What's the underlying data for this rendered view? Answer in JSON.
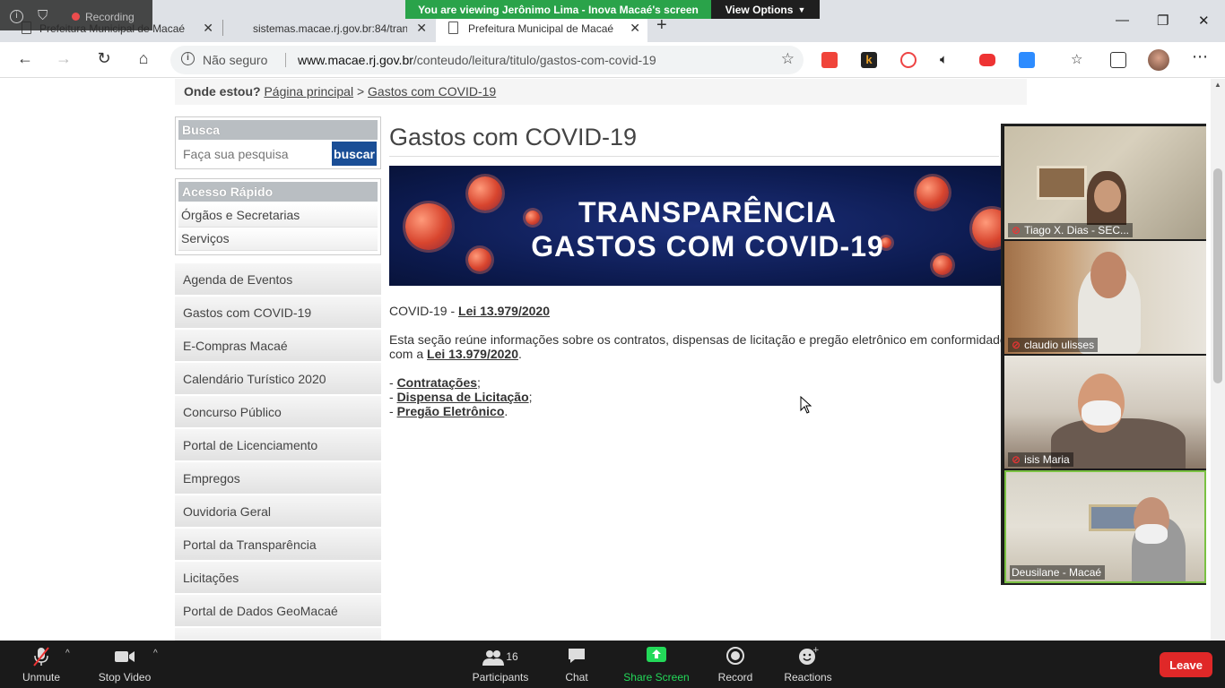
{
  "zoom": {
    "recording_label": "Recording",
    "viewing_banner": "You are viewing Jerônimo Lima - Inova Macaé's screen",
    "view_options_label": "View Options",
    "participants_count": "16",
    "toolbar": {
      "unmute": "Unmute",
      "stop_video": "Stop Video",
      "participants": "Participants",
      "chat": "Chat",
      "share_screen": "Share Screen",
      "record": "Record",
      "reactions": "Reactions",
      "leave": "Leave"
    },
    "participants": [
      {
        "name": "Tiago X. Dias - SEC...",
        "muted": true
      },
      {
        "name": "claudio ulisses",
        "muted": true
      },
      {
        "name": "isis Maria",
        "muted": true
      },
      {
        "name": "Deusilane - Macaé",
        "muted": false
      }
    ],
    "colors": {
      "banner": "#2aa34a",
      "leave": "#e02828",
      "share": "#23d959"
    }
  },
  "browser": {
    "tabs": [
      {
        "title": "Prefeitura Municipal de Macaé",
        "active": false
      },
      {
        "title": "sistemas.macae.rj.gov.br:84/tran",
        "active": false
      },
      {
        "title": "Prefeitura Municipal de Macaé",
        "active": true
      }
    ],
    "security_label": "Não seguro",
    "url_host": "www.macae.rj.gov.br",
    "url_path": "/conteudo/leitura/titulo/gastos-com-covid-19"
  },
  "page": {
    "breadcrumb": {
      "label": "Onde estou?",
      "home": "Página principal",
      "separator": ">",
      "current": "Gastos com COVID-19"
    },
    "search": {
      "heading": "Busca",
      "placeholder": "Faça sua pesquisa",
      "button": "buscar"
    },
    "quick_access": {
      "heading": "Acesso Rápido",
      "items": [
        "Órgãos e Secretarias",
        "Serviços"
      ]
    },
    "menu": [
      "Agenda de Eventos",
      "Gastos com COVID-19",
      "E-Compras Macaé",
      "Calendário Turístico 2020",
      "Concurso Público",
      "Portal de Licenciamento",
      "Empregos",
      "Ouvidoria Geral",
      "Portal da Transparência",
      "Licitações",
      "Portal de Dados GeoMacaé"
    ],
    "title": "Gastos com COVID-19",
    "banner": {
      "line1": "TRANSPARÊNCIA",
      "line2": "GASTOS COM COVID-19"
    },
    "intro_prefix": "COVID-19 - ",
    "law_link": "Lei 13.979/2020",
    "description": "Esta seção reúne informações sobre os contratos, dispensas de licitação e pregão eletrônico em conformidade",
    "description_cont": "com a ",
    "description_end": ".",
    "links": [
      {
        "prefix": "- ",
        "label": "Contratações",
        "suffix": ";"
      },
      {
        "prefix": "- ",
        "label": "Dispensa de Licitação",
        "suffix": ";"
      },
      {
        "prefix": "- ",
        "label": "Pregão Eletrônico",
        "suffix": "."
      }
    ]
  }
}
